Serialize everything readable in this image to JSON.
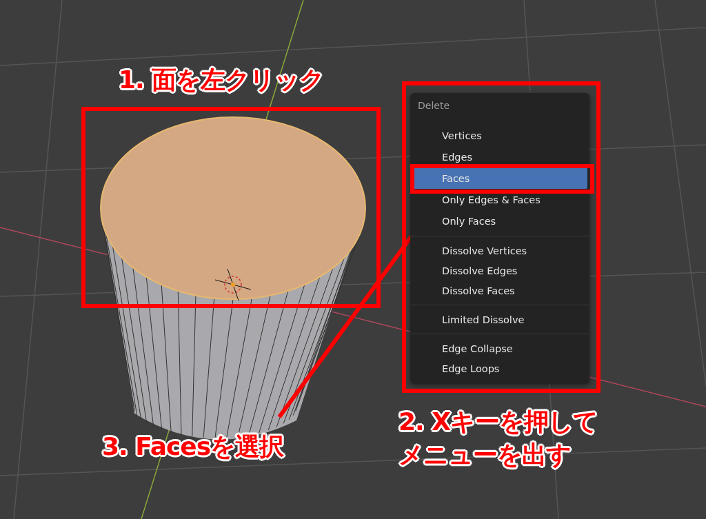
{
  "menu": {
    "title": "Delete",
    "groups": [
      {
        "items": [
          {
            "label": "Vertices",
            "selected": false
          },
          {
            "label": "Edges",
            "selected": false
          },
          {
            "label": "Faces",
            "selected": true
          },
          {
            "label": "Only Edges & Faces",
            "selected": false
          },
          {
            "label": "Only Faces",
            "selected": false
          }
        ]
      },
      {
        "items": [
          {
            "label": "Dissolve Vertices",
            "selected": false
          },
          {
            "label": "Dissolve Edges",
            "selected": false
          },
          {
            "label": "Dissolve Faces",
            "selected": false
          }
        ]
      },
      {
        "items": [
          {
            "label": "Limited Dissolve",
            "selected": false
          }
        ]
      },
      {
        "items": [
          {
            "label": "Edge Collapse",
            "selected": false
          },
          {
            "label": "Edge Loops",
            "selected": false
          }
        ]
      }
    ]
  },
  "annotations": [
    {
      "kind": "step",
      "lines": [
        "1. 面を左クリック"
      ]
    },
    {
      "kind": "step",
      "lines": [
        "3. Facesを選択"
      ]
    },
    {
      "kind": "step",
      "lines": [
        "2. Xキーを押して",
        "メニューを出す"
      ]
    }
  ]
}
